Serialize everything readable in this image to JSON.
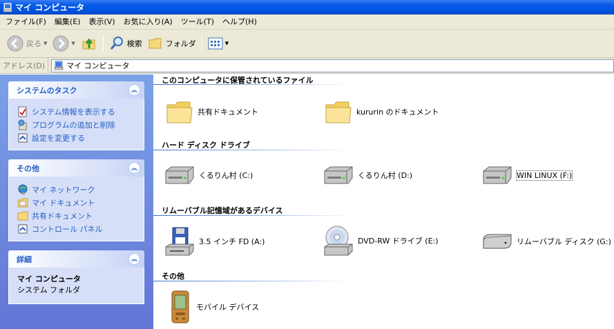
{
  "window": {
    "title": "マイ コンピュータ"
  },
  "menu": [
    "ファイル(F)",
    "編集(E)",
    "表示(V)",
    "お気に入り(A)",
    "ツール(T)",
    "ヘルプ(H)"
  ],
  "toolbar": {
    "back": "戻る",
    "search": "検索",
    "folders": "フォルダ"
  },
  "address": {
    "label": "アドレス(D)",
    "value": "マイ コンピュータ"
  },
  "taskpane": {
    "system_tasks": {
      "title": "システムのタスク",
      "links": [
        "システム情報を表示する",
        "プログラムの追加と削除",
        "設定を変更する"
      ]
    },
    "other": {
      "title": "その他",
      "links": [
        "マイ ネットワーク",
        "マイ ドキュメント",
        "共有ドキュメント",
        "コントロール パネル"
      ]
    },
    "details": {
      "title": "詳細",
      "name": "マイ コンピュータ",
      "type": "システム フォルダ"
    }
  },
  "groups": {
    "stored_files": {
      "title": "このコンピュータに保管されているファイル",
      "items": [
        "共有ドキュメント",
        "kururin のドキュメント"
      ]
    },
    "hard_disks": {
      "title": "ハード ディスク ドライブ",
      "items": [
        "くるりん村 (C:)",
        "くるりん村 (D:)",
        "WIN LINUX (F:)"
      ]
    },
    "removable": {
      "title": "リムーバブル記憶域があるデバイス",
      "items": [
        "3.5 インチ FD (A:)",
        "DVD-RW ドライブ (E:)",
        "リムーバブル ディスク (G:)"
      ]
    },
    "other": {
      "title": "その他",
      "items": [
        "モバイル デバイス"
      ]
    }
  },
  "colors": {
    "title_bar": "#0054e3",
    "taskpane_bg": "#6b8fe0",
    "link": "#215dc6",
    "chrome": "#ece9d8"
  }
}
